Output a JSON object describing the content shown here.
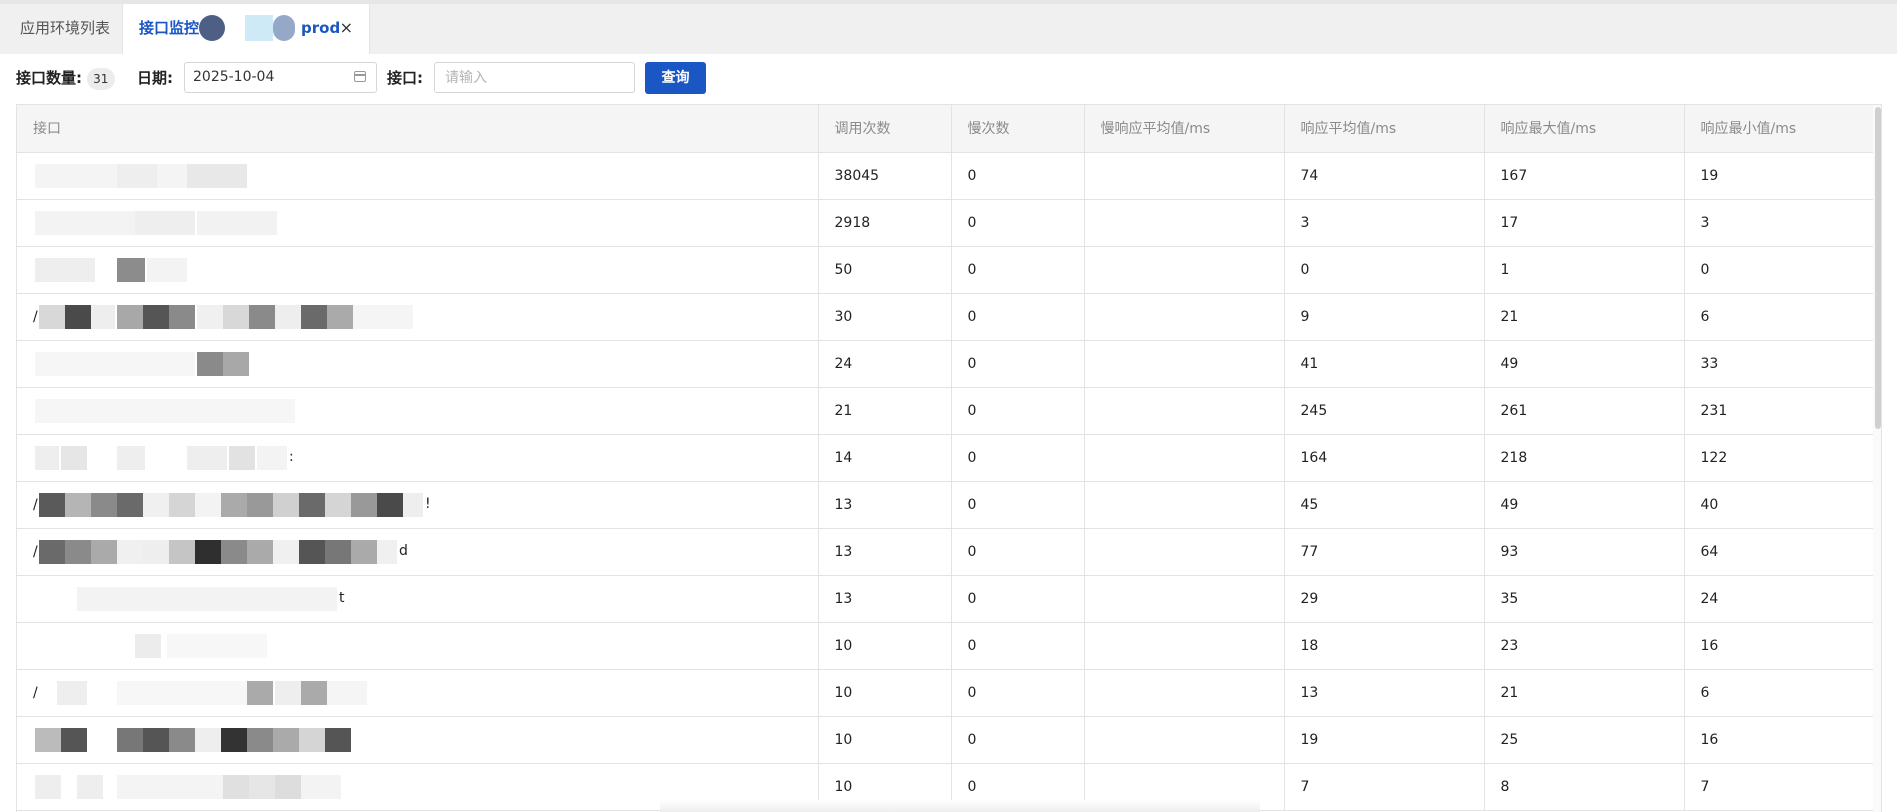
{
  "tabs": {
    "list_label": "应用环境列表",
    "active_label": "接口监控 -",
    "active_suffix": "prod",
    "close_symbol": "×"
  },
  "toolbar": {
    "count_label": "接口数量:",
    "count_value": "31",
    "date_label": "日期:",
    "date_value": "2025-10-04",
    "api_label": "接口:",
    "api_placeholder": "请输入",
    "query_label": "查询"
  },
  "table": {
    "columns": [
      "接口",
      "调用次数",
      "慢次数",
      "慢响应平均值/ms",
      "响应平均值/ms",
      "响应最大值/ms",
      "响应最小值/ms"
    ],
    "rows": [
      {
        "api": "",
        "calls": "38045",
        "slow": "0",
        "slow_avg": "",
        "avg": "74",
        "max": "167",
        "min": "19"
      },
      {
        "api": "",
        "calls": "2918",
        "slow": "0",
        "slow_avg": "",
        "avg": "3",
        "max": "17",
        "min": "3"
      },
      {
        "api": "",
        "calls": "50",
        "slow": "0",
        "slow_avg": "",
        "avg": "0",
        "max": "1",
        "min": "0"
      },
      {
        "api": "/",
        "calls": "30",
        "slow": "0",
        "slow_avg": "",
        "avg": "9",
        "max": "21",
        "min": "6"
      },
      {
        "api": "",
        "calls": "24",
        "slow": "0",
        "slow_avg": "",
        "avg": "41",
        "max": "49",
        "min": "33"
      },
      {
        "api": "",
        "calls": "21",
        "slow": "0",
        "slow_avg": "",
        "avg": "245",
        "max": "261",
        "min": "231"
      },
      {
        "api": "",
        "calls": "14",
        "slow": "0",
        "slow_avg": "",
        "avg": "164",
        "max": "218",
        "min": "122"
      },
      {
        "api": "/",
        "calls": "13",
        "slow": "0",
        "slow_avg": "",
        "avg": "45",
        "max": "49",
        "min": "40"
      },
      {
        "api": "/",
        "calls": "13",
        "slow": "0",
        "slow_avg": "",
        "avg": "77",
        "max": "93",
        "min": "64"
      },
      {
        "api": "",
        "calls": "13",
        "slow": "0",
        "slow_avg": "",
        "avg": "29",
        "max": "35",
        "min": "24"
      },
      {
        "api": "",
        "calls": "10",
        "slow": "0",
        "slow_avg": "",
        "avg": "18",
        "max": "23",
        "min": "16"
      },
      {
        "api": "/",
        "calls": "10",
        "slow": "0",
        "slow_avg": "",
        "avg": "13",
        "max": "21",
        "min": "6"
      },
      {
        "api": "",
        "calls": "10",
        "slow": "0",
        "slow_avg": "",
        "avg": "19",
        "max": "25",
        "min": "16"
      },
      {
        "api": "",
        "calls": "10",
        "slow": "0",
        "slow_avg": "",
        "avg": "7",
        "max": "8",
        "min": "7"
      }
    ]
  },
  "colors": {
    "accent": "#1a56c4",
    "redact_dark": "#4a4a4a",
    "redact_light": "#eeeeee"
  }
}
